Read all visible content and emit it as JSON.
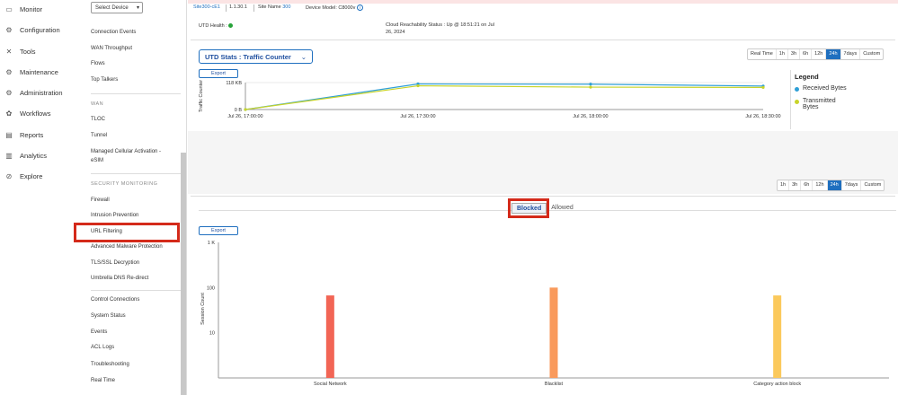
{
  "nav": {
    "items": [
      {
        "label": "Monitor",
        "icon": "monitor-icon"
      },
      {
        "label": "Configuration",
        "icon": "configuration-icon"
      },
      {
        "label": "Tools",
        "icon": "tools-icon"
      },
      {
        "label": "Maintenance",
        "icon": "maintenance-icon"
      },
      {
        "label": "Administration",
        "icon": "administration-icon"
      },
      {
        "label": "Workflows",
        "icon": "workflows-icon"
      },
      {
        "label": "Reports",
        "icon": "reports-icon"
      },
      {
        "label": "Analytics",
        "icon": "analytics-icon"
      },
      {
        "label": "Explore",
        "icon": "explore-icon"
      }
    ]
  },
  "submenu": {
    "select_device": "Select Device",
    "items_top": [
      "Connection Events",
      "WAN Throughput",
      "Flows",
      "Top Talkers"
    ],
    "wan_header": "WAN",
    "wan_items": [
      "TLOC",
      "Tunnel",
      "Managed Cellular Activation -",
      "eSIM"
    ],
    "security_header": "SECURITY MONITORING",
    "security_items": [
      "Firewall",
      "Intrusion Prevention",
      "URL Filtering",
      "Advanced Malware Protection",
      "TLS/SSL Decryption",
      "Umbrella DNS Re-direct"
    ],
    "bottom_items": [
      "Control Connections",
      "System Status",
      "Events",
      "ACL Logs",
      "Troubleshooting",
      "Real Time"
    ]
  },
  "header": {
    "device_name": "Site300-cE1",
    "ip": "1.1.30.1",
    "site_label": "Site Name",
    "site_value": "300",
    "model_label": "Device Model:",
    "model_value": "C8000v",
    "info_glyph": "i",
    "utd_health_label": "UTD Health :",
    "cloud_line1": "Cloud Reachability Status : Up @ 18:51:21 on Jul",
    "cloud_line2": "26, 2024"
  },
  "utd_dropdown": {
    "label": "UTD Stats : Traffic Counter"
  },
  "time_range_top": {
    "options": [
      "Real Time",
      "1h",
      "3h",
      "6h",
      "12h",
      "24h",
      "7days",
      "Custom"
    ],
    "selected": "24h"
  },
  "time_range_bottom": {
    "options": [
      "1h",
      "3h",
      "6h",
      "12h",
      "24h",
      "7days",
      "Custom"
    ],
    "selected": "24h"
  },
  "export_label": "Export",
  "legend": {
    "title": "Legend",
    "received": "Received Bytes",
    "transmitted_1": "Transmitted",
    "transmitted_2": "Bytes"
  },
  "tabs": {
    "blocked": "Blocked",
    "allowed": "Allowed"
  },
  "colors": {
    "accent": "#1f6fbf",
    "received": "#2e9fd6",
    "transmitted": "#c8d42a",
    "highlight": "#d42a1a"
  },
  "chart_data": [
    {
      "type": "line",
      "ylabel": "Traffic Counter",
      "y_ticks": [
        "0 B",
        "118 KB"
      ],
      "ylim": [
        0,
        118
      ],
      "x_labels": [
        "Jul 26, 17:00:00",
        "Jul 26, 17:30:00",
        "Jul 26, 18:00:00",
        "Jul 26, 18:30:00"
      ],
      "x": [
        0,
        1,
        2,
        3
      ],
      "series": [
        {
          "name": "Received Bytes",
          "values": [
            0,
            112,
            111,
            103
          ]
        },
        {
          "name": "Transmitted Bytes",
          "values": [
            0,
            104,
            98,
            97
          ]
        }
      ]
    },
    {
      "type": "bar",
      "ylabel": "Session Count",
      "y_scale": "log",
      "y_ticks": [
        "10",
        "100",
        "1 K"
      ],
      "categories": [
        "Social Network",
        "Blacklist",
        "Category action block"
      ],
      "values": [
        67,
        100,
        67
      ],
      "bar_colors": [
        "#f26555",
        "#f99a5c",
        "#fbc95c"
      ]
    }
  ]
}
